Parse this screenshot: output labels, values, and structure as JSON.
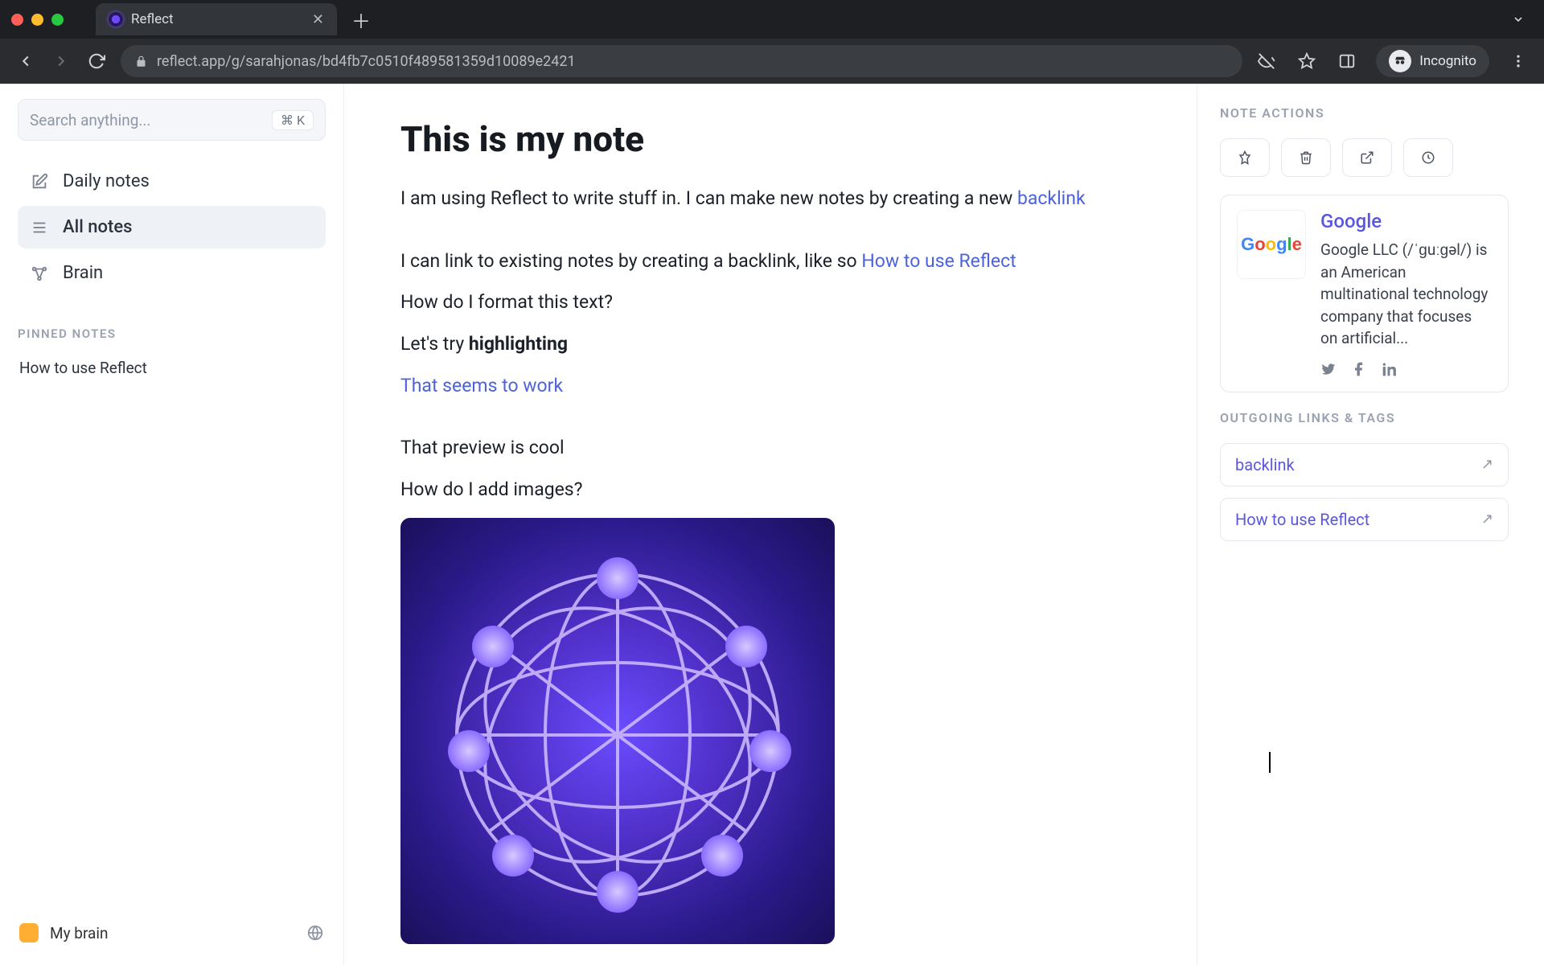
{
  "browser": {
    "tab_title": "Reflect",
    "url": "reflect.app/g/sarahjonas/bd4fb7c0510f489581359d10089e2421",
    "incognito_label": "Incognito"
  },
  "sidebar": {
    "search_placeholder": "Search anything...",
    "search_shortcut": "⌘ K",
    "items": [
      {
        "label": "Daily notes",
        "icon": "edit"
      },
      {
        "label": "All notes",
        "icon": "list",
        "active": true
      },
      {
        "label": "Brain",
        "icon": "network"
      }
    ],
    "pinned_label": "PINNED NOTES",
    "pinned": [
      {
        "label": "How to use Reflect"
      }
    ],
    "footer_label": "My brain"
  },
  "note": {
    "title": "This is my note",
    "p1_pre": "I am using Reflect to write stuff in. I can make new notes by creating a new ",
    "p1_link": "backlink",
    "p2_pre": "I can link to existing notes by creating a backlink, like so ",
    "p2_link": "How to use Reflect",
    "p3": "How do I format this text?",
    "p4_pre": "Let's try ",
    "p4_bold": "highlighting",
    "p5_link": "That seems to work",
    "p6": "That preview is cool",
    "p7": "How do I add images?"
  },
  "actions": {
    "label": "NOTE ACTIONS"
  },
  "infocard": {
    "title": "Google",
    "desc": "Google LLC (/ˈɡuːɡəl/) is an American multinational technology company that focuses on artificial..."
  },
  "outgoing": {
    "label": "OUTGOING LINKS & TAGS",
    "items": [
      {
        "label": "backlink"
      },
      {
        "label": "How to use Reflect"
      }
    ]
  }
}
